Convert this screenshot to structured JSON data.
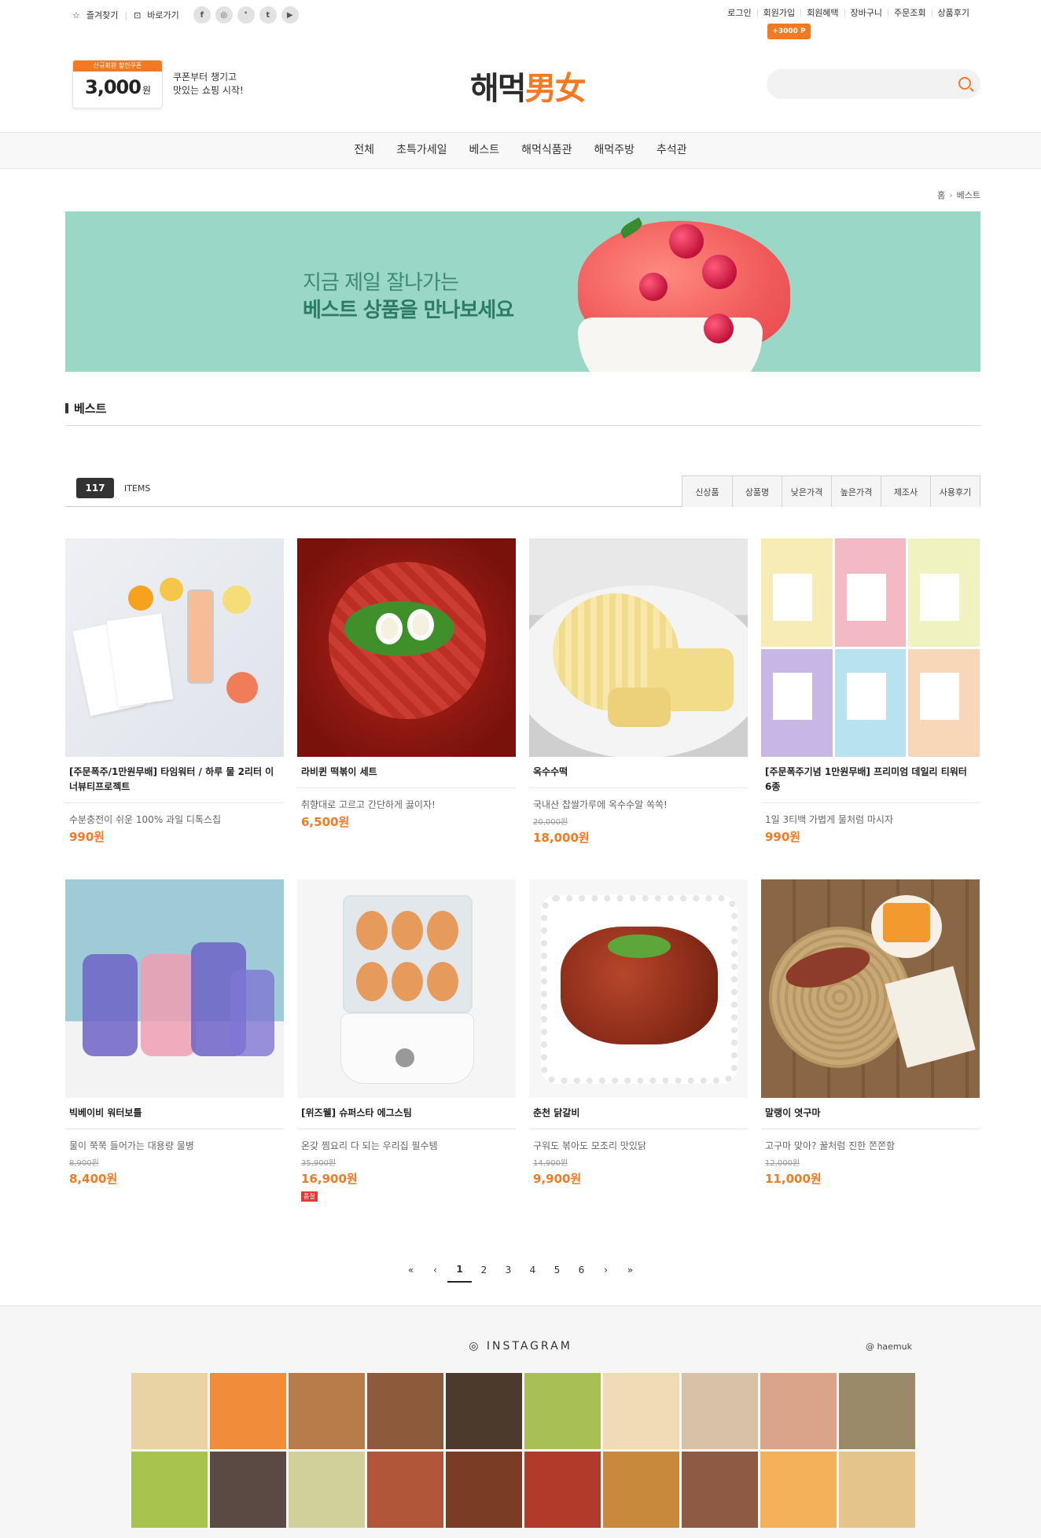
{
  "top": {
    "bookmark": "즐겨찾기",
    "shortcut": "바로가기",
    "sns": [
      "f",
      "◎",
      "❜",
      "t",
      "▶"
    ],
    "links": [
      "로그인",
      "회원가입",
      "회원혜택",
      "장바구니",
      "주문조회",
      "상품후기"
    ],
    "point_badge": "+3000 P"
  },
  "header": {
    "coupon_tag": "신규회원 할인쿠폰",
    "coupon_amount": "3,000",
    "coupon_unit": "원",
    "coupon_text_1": "쿠폰부터 챙기고",
    "coupon_text_2": "맛있는 쇼핑 시작!",
    "logo_a": "해먹",
    "logo_b": "男女",
    "search_placeholder": ""
  },
  "nav": [
    "전체",
    "초특가세일",
    "베스트",
    "해먹식품관",
    "해먹주방",
    "추석관"
  ],
  "breadcrumb": {
    "home": "홈",
    "current": "베스트"
  },
  "banner": {
    "line1": "지금 제일 잘나가는",
    "line2": "베스트 상품을 만나보세요"
  },
  "section_title": "베스트",
  "list": {
    "count": "117",
    "items_label": "ITEMS",
    "sort": [
      "신상품",
      "상품명",
      "낮은가격",
      "높은가격",
      "제조사",
      "사용후기"
    ]
  },
  "products": [
    {
      "name": "[주문폭주/1만원무배] 타임워터 / 하루 물 2리터 이너뷰티프로젝트",
      "desc": "수분충전이 쉬운 100% 과일 디톡스칩",
      "old": "",
      "price": "990원",
      "badge": ""
    },
    {
      "name": "라비퀸 떡볶이 세트",
      "desc": "취향대로 고르고 간단하게 끓이자!",
      "old": "",
      "price": "6,500원",
      "badge": ""
    },
    {
      "name": "옥수수떡",
      "desc": "국내산 찹쌀가루에 옥수수알 쏙쏙!",
      "old": "20,000원",
      "price": "18,000원",
      "badge": ""
    },
    {
      "name": "[주문폭주기념 1만원무배] 프리미엄 데일리 티워터 6종",
      "desc": "1일 3티백 가볍게 물처럼 마시자",
      "old": "",
      "price": "990원",
      "badge": ""
    },
    {
      "name": "빅베이비 워터보틀",
      "desc": "물이 쭉쭉 들어가는 대용량 물병",
      "old": "8,900원",
      "price": "8,400원",
      "badge": ""
    },
    {
      "name": "[위즈웰] 슈퍼스타 에그스팀",
      "desc": "온갖 찜요리 다 되는 우리집 필수템",
      "old": "35,900원",
      "price": "16,900원",
      "badge": "품절"
    },
    {
      "name": "춘천 닭갈비",
      "desc": "구워도 볶아도 모조리 맛있닭",
      "old": "14,900원",
      "price": "9,900원",
      "badge": ""
    },
    {
      "name": "말랭이 엿구마",
      "desc": "고구마 맞아? 꿀처럼 진한 쫀쫀함",
      "old": "12,000원",
      "price": "11,000원",
      "badge": ""
    }
  ],
  "pagination": {
    "first": "«",
    "prev": "‹",
    "pages": [
      "1",
      "2",
      "3",
      "4",
      "5",
      "6"
    ],
    "next": "›",
    "last": "»"
  },
  "instagram": {
    "title": "INSTAGRAM",
    "handle": "@ haemuk"
  },
  "colors": {
    "accent": "#f47921",
    "banner": "#9bd7c6"
  }
}
